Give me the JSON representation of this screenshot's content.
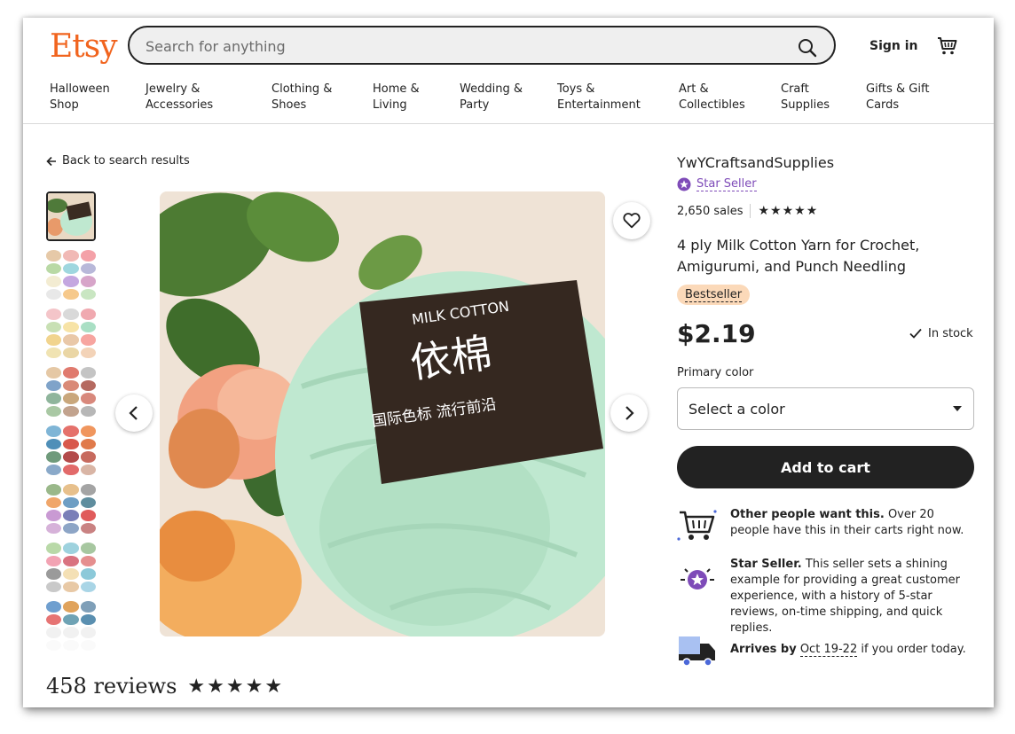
{
  "header": {
    "logo": "Etsy",
    "search_placeholder": "Search for anything",
    "signin_label": "Sign in",
    "nav": [
      {
        "label": "Halloween\nShop"
      },
      {
        "label": "Jewelry &\nAccessories"
      },
      {
        "label": "Clothing &\nShoes"
      },
      {
        "label": "Home &\nLiving"
      },
      {
        "label": "Wedding &\nParty"
      },
      {
        "label": "Toys &\nEntertainment"
      },
      {
        "label": "Art &\nCollectibles"
      },
      {
        "label": "Craft\nSupplies"
      },
      {
        "label": "Gifts & Gift\nCards"
      }
    ]
  },
  "main": {
    "back_label": "Back to search results",
    "image": {
      "band_text_1": "MILK COTTON",
      "band_text_2": "依棉",
      "band_text_3": "国际色标  流行前沿"
    }
  },
  "product": {
    "shop_name": "YwYCraftsandSupplies",
    "star_seller_label": "Star Seller",
    "sales": "2,650 sales",
    "rating_stars": "★★★★★",
    "title": "4 ply Milk Cotton Yarn for Crochet, Amigurumi, and Punch Needling",
    "badge": "Bestseller",
    "price": "$2.19",
    "stock": "In stock",
    "color_label": "Primary color",
    "color_select": "Select a color",
    "add_to_cart": "Add to cart",
    "info": {
      "demand_bold": "Other people want this.",
      "demand_text": " Over 20 people have this in their carts right now.",
      "star_bold": "Star Seller.",
      "star_text": " This seller sets a shining example for providing a great customer experience, with a history of 5-star reviews, on-time shipping, and quick replies.",
      "arrives_bold": "Arrives by",
      "arrives_dates": "Oct 19-22",
      "arrives_text": " if you order today."
    }
  },
  "reviews": {
    "count": "458 reviews",
    "stars": "★★★★★"
  },
  "colors": {
    "brand": "#f1641e",
    "star_seller": "#7e4bb8",
    "bestseller_badge": "#fbd9b9",
    "yarn_mint": "#bfe8d0"
  }
}
